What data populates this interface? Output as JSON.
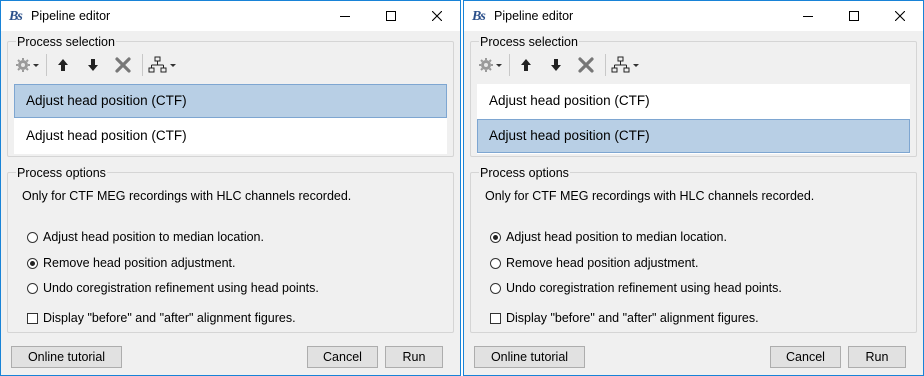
{
  "colors": {
    "accent": "#1883d7",
    "selected_row": "#b8cfe5"
  },
  "windows": [
    {
      "title": "Pipeline editor",
      "app_icon_text": "Bs",
      "process_selection_label": "Process selection",
      "toolbar_icons": [
        "gear-icon",
        "arrow-up-icon",
        "arrow-down-icon",
        "delete-icon",
        "pipeline-icon"
      ],
      "processes": [
        {
          "label": "Adjust head position (CTF)",
          "selected": true
        },
        {
          "label": "Adjust head position (CTF)",
          "selected": false
        }
      ],
      "process_options_label": "Process options",
      "options_description": "Only for CTF MEG recordings with HLC channels recorded.",
      "radio_options": [
        {
          "label": "Adjust head position to median location.",
          "checked": false
        },
        {
          "label": "Remove head position adjustment.",
          "checked": true
        },
        {
          "label": "Undo coregistration refinement using head points.",
          "checked": false
        }
      ],
      "checkbox": {
        "label": "Display \"before\" and \"after\" alignment figures.",
        "checked": false
      },
      "buttons": {
        "tutorial": "Online tutorial",
        "cancel": "Cancel",
        "run": "Run"
      }
    },
    {
      "title": "Pipeline editor",
      "app_icon_text": "Bs",
      "process_selection_label": "Process selection",
      "toolbar_icons": [
        "gear-icon",
        "arrow-up-icon",
        "arrow-down-icon",
        "delete-icon",
        "pipeline-icon"
      ],
      "processes": [
        {
          "label": "Adjust head position (CTF)",
          "selected": false
        },
        {
          "label": "Adjust head position (CTF)",
          "selected": true
        }
      ],
      "process_options_label": "Process options",
      "options_description": "Only for CTF MEG recordings with HLC channels recorded.",
      "radio_options": [
        {
          "label": "Adjust head position to median location.",
          "checked": true
        },
        {
          "label": "Remove head position adjustment.",
          "checked": false
        },
        {
          "label": "Undo coregistration refinement using head points.",
          "checked": false
        }
      ],
      "checkbox": {
        "label": "Display \"before\" and \"after\" alignment figures.",
        "checked": false
      },
      "buttons": {
        "tutorial": "Online tutorial",
        "cancel": "Cancel",
        "run": "Run"
      }
    }
  ]
}
